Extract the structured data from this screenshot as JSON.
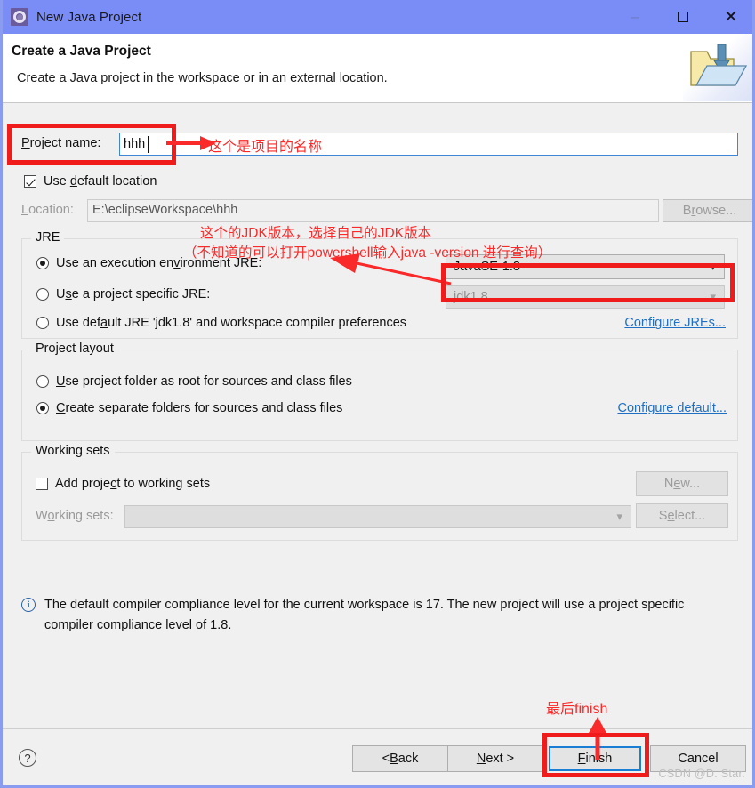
{
  "window": {
    "title": "New Java Project",
    "icon": "eclipse-wizard-icon",
    "minimize": "–",
    "maximize": "□",
    "close": "✕"
  },
  "header": {
    "title": "Create a Java Project",
    "subtitle": "Create a Java project in the workspace or in an external location.",
    "art_icon": "open-folder-icon"
  },
  "form": {
    "project_name_label": "Project name:",
    "project_name_value": "hhh",
    "use_default_location_label": "Use default location",
    "use_default_location_checked": true,
    "location_label": "Location:",
    "location_value": "E:\\eclipseWorkspace\\hhh",
    "browse_label": "Browse..."
  },
  "jre": {
    "group_title": "JRE",
    "option_execution_env": "Use an execution environment JRE:",
    "option_project_specific": "Use a project specific JRE:",
    "option_default_jre": "Use default JRE 'jdk1.8' and workspace compiler preferences",
    "selected": "execution_env",
    "execution_env_value": "JavaSE-1.8",
    "project_specific_value": "jdk1.8",
    "configure_jres_link": "Configure JREs..."
  },
  "project_layout": {
    "group_title": "Project layout",
    "option_project_folder_root": "Use project folder as root for sources and class files",
    "option_separate_folders": "Create separate folders for sources and class files",
    "selected": "separate_folders",
    "configure_default_link": "Configure default..."
  },
  "working_sets": {
    "group_title": "Working sets",
    "add_project_label": "Add project to working sets",
    "add_project_checked": false,
    "working_sets_label": "Working sets:",
    "working_sets_value": "",
    "new_label": "New...",
    "select_label": "Select..."
  },
  "info": {
    "icon": "info-circle-icon",
    "message": "The default compiler compliance level for the current workspace is 17. The new project will use a project specific compiler compliance level of 1.8."
  },
  "footer": {
    "help_icon": "?",
    "back_label": "< Back",
    "next_label": "Next >",
    "finish_label": "Finish",
    "cancel_label": "Cancel"
  },
  "annotations": {
    "project_name_note": "这个是项目的名称",
    "jdk_note_line1": "这个的JDK版本，选择自己的JDK版本",
    "jdk_note_line2": "（不知道的可以打开powershell输入java -version 进行查询）",
    "finish_note": "最后finish",
    "accent_color": "#fa2a2a"
  },
  "watermark": "CSDN @D. Star."
}
